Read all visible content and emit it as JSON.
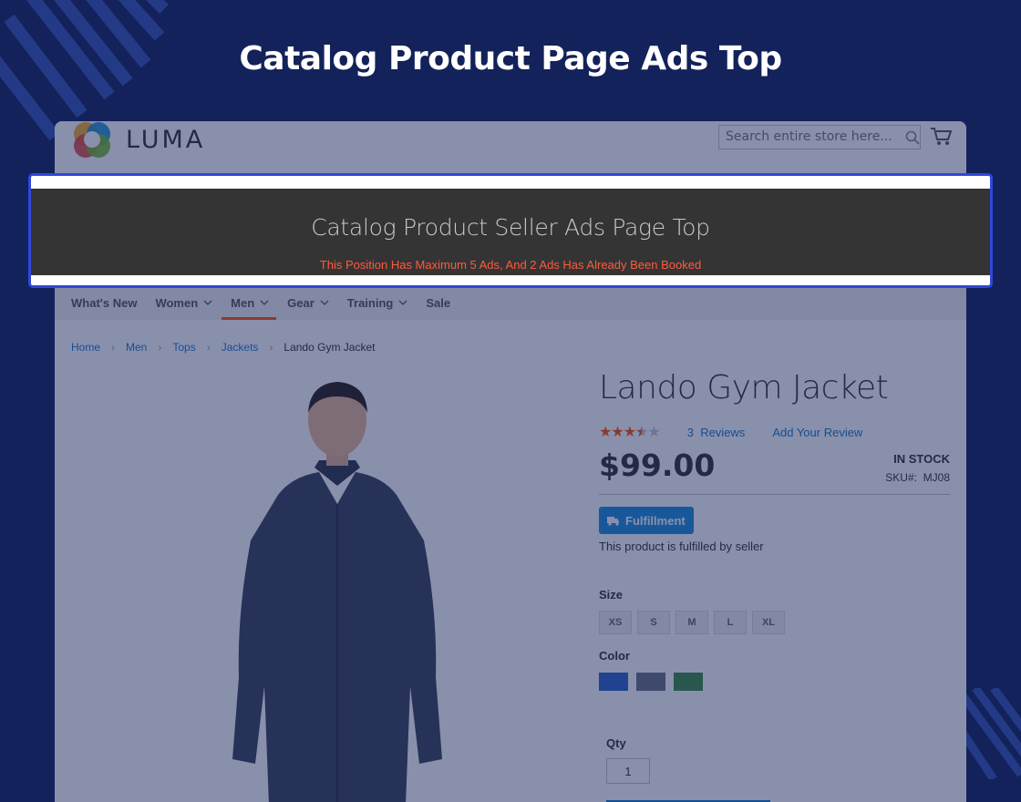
{
  "heading": "Catalog Product Page Ads Top",
  "store": {
    "logo_text": "LUMA",
    "search": {
      "placeholder": "Search entire store here..."
    },
    "nav": [
      {
        "label": "What's New",
        "has_menu": false
      },
      {
        "label": "Women",
        "has_menu": true
      },
      {
        "label": "Men",
        "has_menu": true,
        "active": true
      },
      {
        "label": "Gear",
        "has_menu": true
      },
      {
        "label": "Training",
        "has_menu": true
      },
      {
        "label": "Sale",
        "has_menu": false
      }
    ],
    "breadcrumbs": [
      "Home",
      "Men",
      "Tops",
      "Jackets"
    ],
    "breadcrumb_current": "Lando Gym Jacket"
  },
  "ad_slot": {
    "title": "Catalog Product Seller Ads Page Top",
    "note": "This Position Has Maximum 5 Ads, And 2 Ads Has Already Been Booked"
  },
  "product": {
    "name": "Lando Gym Jacket",
    "rating_stars": 3.5,
    "rating_max": 5,
    "reviews_count": "3",
    "reviews_label": "Reviews",
    "add_review": "Add Your Review",
    "price": "$99.00",
    "stock": "IN STOCK",
    "sku_label": "SKU#:",
    "sku": "MJ08",
    "badge": "Fulfillment",
    "fulfilled_text": "This product is fulfilled by seller",
    "size_label": "Size",
    "sizes": [
      "XS",
      "S",
      "M",
      "L",
      "XL"
    ],
    "color_label": "Color",
    "colors": [
      "#2a62c9",
      "#6b7280",
      "#3e8c40"
    ],
    "qty_label": "Qty",
    "qty_value": "1"
  },
  "colors": {
    "background": "#13225a",
    "accent": "#1979c3",
    "ad_border": "#2f47d9",
    "ad_note": "#ff5a3c",
    "nav_active": "#ff5501"
  }
}
